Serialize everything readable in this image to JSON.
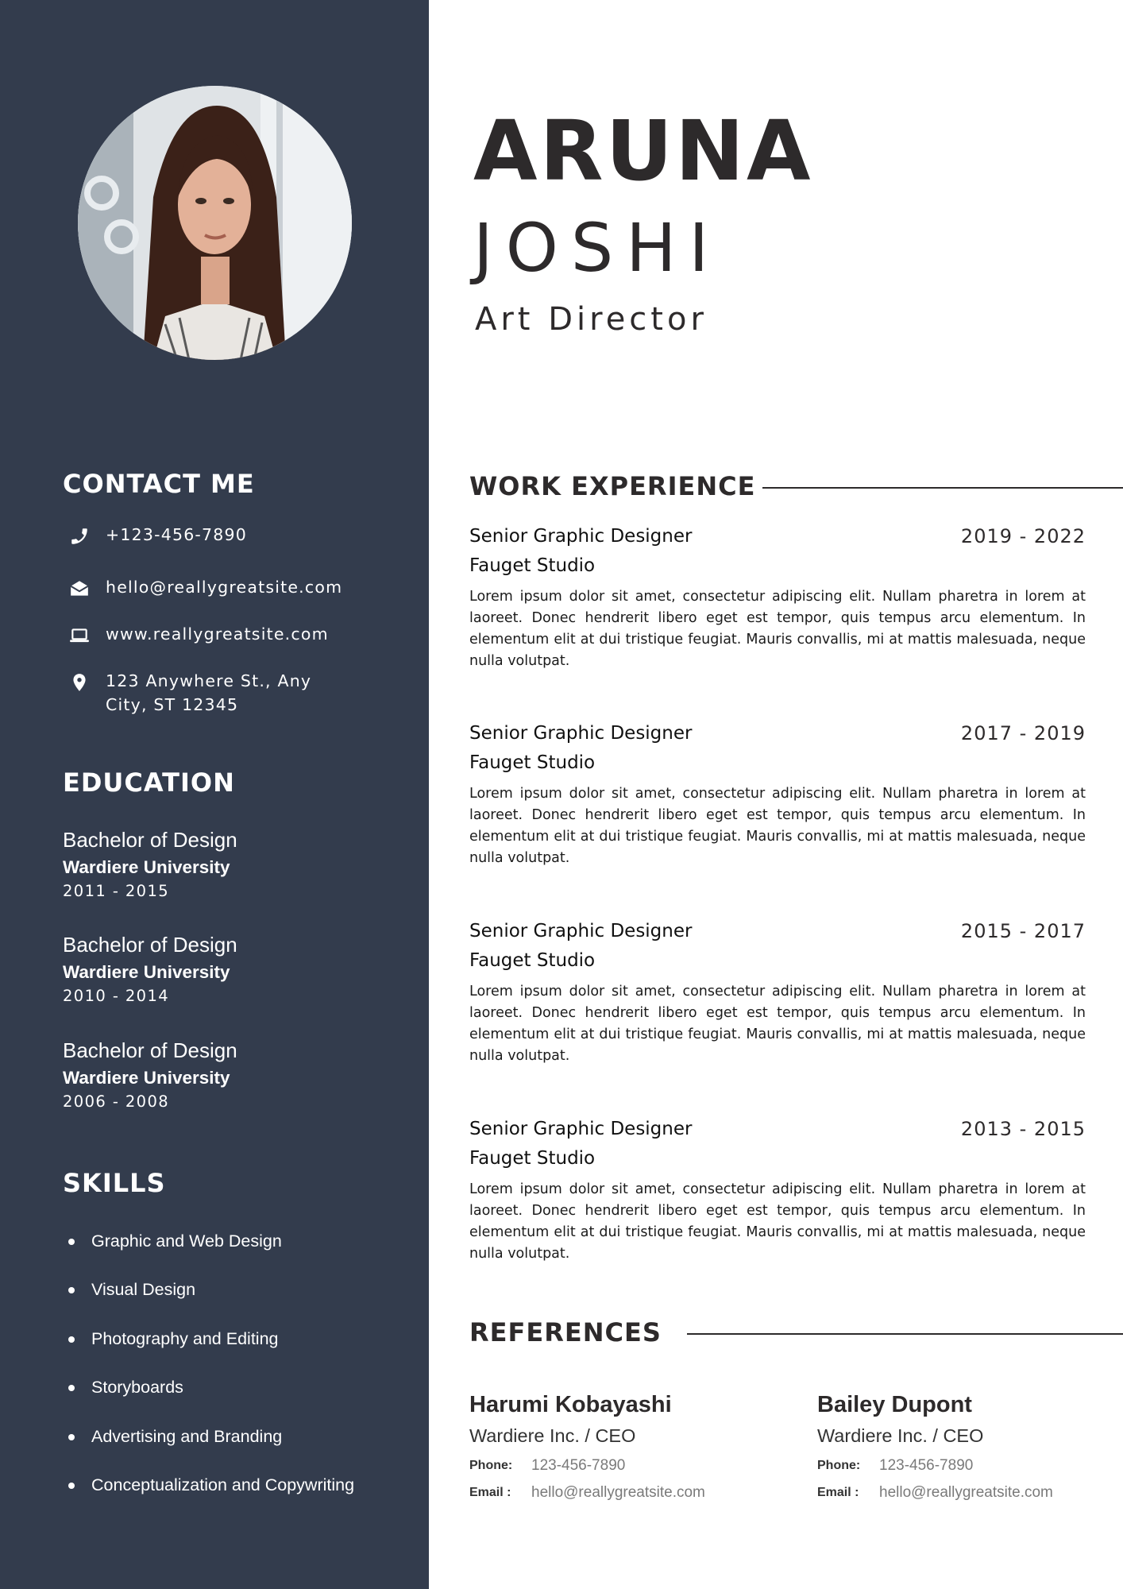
{
  "name": {
    "first": "ARUNA",
    "last": "JOSHI"
  },
  "title": "Art Director",
  "contact": {
    "heading": "CONTACT ME",
    "items": [
      {
        "icon": "phone-icon",
        "text": "+123-456-7890"
      },
      {
        "icon": "email-icon",
        "text": "hello@reallygreatsite.com"
      },
      {
        "icon": "laptop-icon",
        "text": "www.reallygreatsite.com"
      },
      {
        "icon": "location-pin-icon",
        "text": "123 Anywhere St., Any",
        "text2": "City, ST 12345"
      }
    ]
  },
  "education": {
    "heading": "EDUCATION",
    "items": [
      {
        "degree": "Bachelor of Design",
        "school": "Wardiere University",
        "years": "2011 - 2015"
      },
      {
        "degree": "Bachelor of Design",
        "school": "Wardiere University",
        "years": "2010 - 2014"
      },
      {
        "degree": "Bachelor of Design",
        "school": "Wardiere University",
        "years": "2006 - 2008"
      }
    ]
  },
  "skills": {
    "heading": "SKILLS",
    "items": [
      "Graphic and Web Design",
      "Visual Design",
      "Photography and Editing",
      "Storyboards",
      "Advertising and Branding",
      "Conceptualization and Copywriting"
    ]
  },
  "work": {
    "heading": "WORK EXPERIENCE",
    "items": [
      {
        "role": "Senior Graphic Designer",
        "company": "Fauget Studio",
        "years": "2019 - 2022",
        "description": "Lorem ipsum dolor sit amet, consectetur adipiscing elit. Nullam pharetra in lorem at laoreet. Donec hendrerit libero eget est tempor, quis tempus arcu elementum. In elementum elit at dui tristique feugiat. Mauris convallis, mi at mattis malesuada, neque nulla volutpat."
      },
      {
        "role": "Senior Graphic Designer",
        "company": "Fauget Studio",
        "years": "2017 - 2019",
        "description": "Lorem ipsum dolor sit amet, consectetur adipiscing elit. Nullam pharetra in lorem at laoreet. Donec hendrerit libero eget est tempor, quis tempus arcu elementum. In elementum elit at dui tristique feugiat. Mauris convallis, mi at mattis malesuada, neque nulla volutpat."
      },
      {
        "role": "Senior Graphic Designer",
        "company": "Fauget Studio",
        "years": "2015 - 2017",
        "description": "Lorem ipsum dolor sit amet, consectetur adipiscing elit. Nullam pharetra in lorem at laoreet. Donec hendrerit libero eget est tempor, quis tempus arcu elementum. In elementum elit at dui tristique feugiat. Mauris convallis, mi at mattis malesuada, neque nulla volutpat."
      },
      {
        "role": "Senior Graphic Designer",
        "company": "Fauget Studio",
        "years": "2013 - 2015",
        "description": "Lorem ipsum dolor sit amet, consectetur adipiscing elit. Nullam pharetra in lorem at laoreet. Donec hendrerit libero eget est tempor, quis tempus arcu elementum. In elementum elit at dui tristique feugiat. Mauris convallis, mi at mattis malesuada, neque nulla volutpat."
      }
    ]
  },
  "references": {
    "heading": "REFERENCES",
    "items": [
      {
        "name": "Harumi Kobayashi",
        "org": "Wardiere Inc. / CEO",
        "phone_label": "Phone:",
        "phone": "123-456-7890",
        "email_label": "Email :",
        "email": "hello@reallygreatsite.com"
      },
      {
        "name": "Bailey Dupont",
        "org": "Wardiere Inc. / CEO",
        "phone_label": "Phone:",
        "phone": "123-456-7890",
        "email_label": "Email :",
        "email": "hello@reallygreatsite.com"
      }
    ]
  },
  "colors": {
    "sidebar": "#333c4d",
    "text_dark": "#2d2a2b",
    "muted": "#7a7a7a"
  }
}
